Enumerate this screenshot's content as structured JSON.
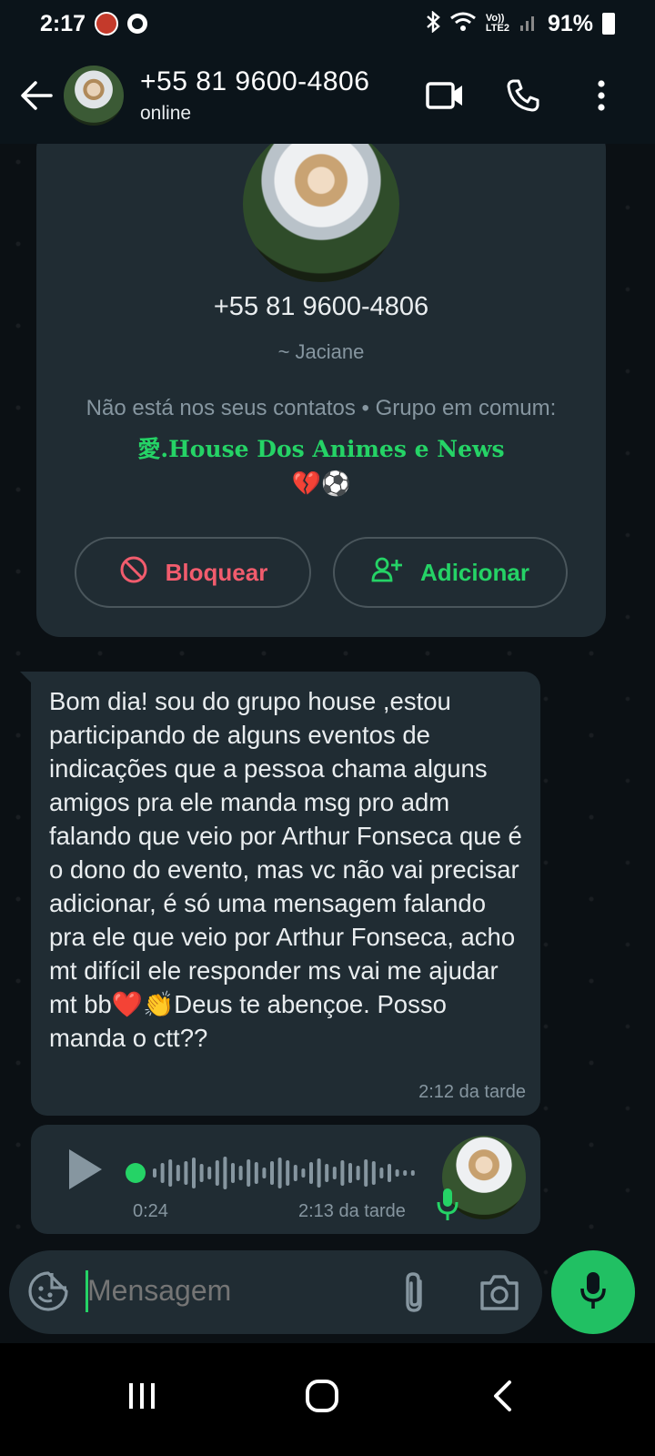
{
  "status_bar": {
    "time": "2:17",
    "lte_label": "Vo))\nLTE2",
    "battery": "91%"
  },
  "header": {
    "title": "+55 81 9600-4806",
    "status": "online",
    "icons": [
      "back-arrow-icon",
      "video-call-icon",
      "voice-call-icon",
      "more-vert-icon"
    ]
  },
  "contact_card": {
    "phone": "+55 81 9600-4806",
    "name": "~ Jaciane",
    "note_prefix": "Não está nos seus contatos • Grupo em comum: ",
    "group_name": "愛.House Dos Animes e News",
    "group_emojis": "💔⚽",
    "block_label": "Bloquear",
    "add_label": "Adicionar"
  },
  "messages": [
    {
      "type": "text",
      "text": "Bom dia! sou do grupo house ,estou participando de alguns eventos de indicações que a pessoa chama alguns amigos pra ele manda msg pro adm falando que veio por Arthur Fonseca que é o dono do evento, mas vc não vai precisar adicionar, é só uma mensagem falando pra ele que veio por Arthur Fonseca, acho mt difícil ele responder ms vai me ajudar mt bb❤️👏Deus te abençoe. Posso manda o ctt??",
      "time": "2:12 da tarde"
    },
    {
      "type": "audio",
      "duration": "0:24",
      "time": "2:13 da tarde"
    }
  ],
  "composer": {
    "placeholder": "Mensagem"
  },
  "colors": {
    "accent": "#25d366",
    "danger": "#f15c6d",
    "bubble": "#202c33",
    "header": "#0b141a"
  }
}
